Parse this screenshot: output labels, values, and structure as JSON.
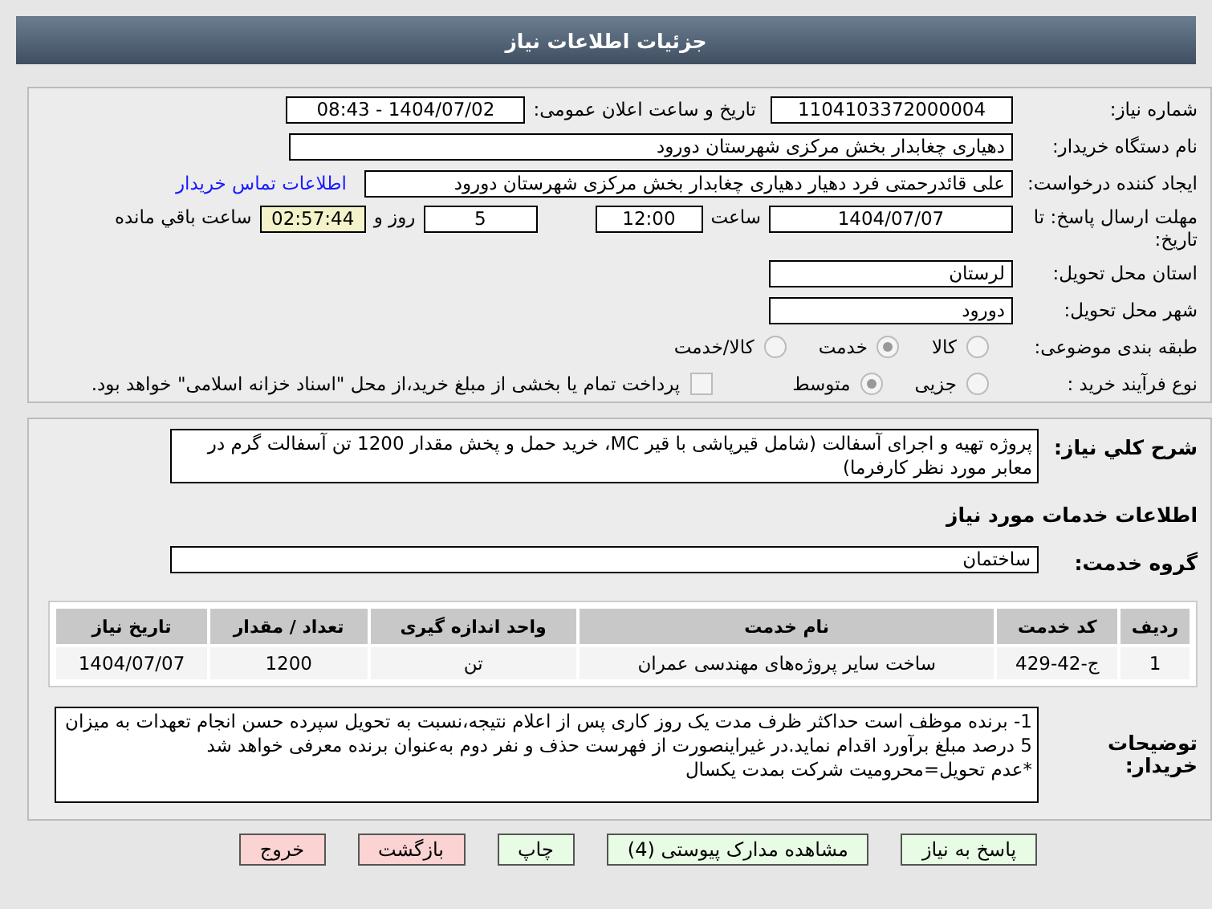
{
  "window": {
    "title": "جزئیات اطلاعات نیاز"
  },
  "form": {
    "need_number": {
      "label": "شماره نیاز:",
      "value": "1104103372000004"
    },
    "announce": {
      "label": "تاریخ و ساعت اعلان عمومی:",
      "value": "1404/07/02 - 08:43"
    },
    "buyer_org": {
      "label": "نام دستگاه خریدار:",
      "value": "دهیاری چغابدار بخش مرکزی شهرستان دورود"
    },
    "requester": {
      "label": "ایجاد کننده درخواست:",
      "value": "علی قائدرحمتی فرد دهیار دهیاری چغابدار بخش مرکزی شهرستان دورود",
      "link": "اطلاعات تماس خریدار"
    },
    "deadline": {
      "label": "مهلت ارسال پاسخ: تا تاریخ:",
      "date": "1404/07/07",
      "time_label": "ساعت",
      "time": "12:00",
      "days": "5",
      "days_label": "روز و",
      "remaining": "02:57:44",
      "remaining_label": "ساعت باقي مانده"
    },
    "province": {
      "label": "استان محل تحویل:",
      "value": "لرستان"
    },
    "city": {
      "label": "شهر محل تحویل:",
      "value": "دورود"
    },
    "category": {
      "label": "طبقه بندی موضوعی:",
      "options": [
        {
          "label": "کالا",
          "selected": false
        },
        {
          "label": "خدمت",
          "selected": true
        },
        {
          "label": "کالا/خدمت",
          "selected": false
        }
      ]
    },
    "process": {
      "label": "نوع فرآیند خرید :",
      "options": [
        {
          "label": "جزیی",
          "selected": false
        },
        {
          "label": "متوسط",
          "selected": true
        }
      ],
      "payment": {
        "label": "پرداخت تمام یا بخشی از مبلغ خرید،از محل \"اسناد خزانه اسلامی\" خواهد بود.",
        "checked": false
      }
    }
  },
  "details": {
    "description": {
      "label": "شرح کلي نياز:",
      "value": "پروژه تهیه و اجرای آسفالت (شامل قیرپاشی با قیر MC، خرید حمل و پخش مقدار 1200 تن آسفالت گرم در معابر مورد نظر کارفرما)"
    },
    "services_title": "اطلاعات خدمات مورد نیاز",
    "service_group": {
      "label": "گروه خدمت:",
      "value": "ساختمان"
    },
    "table": {
      "columns": [
        "ردیف",
        "کد خدمت",
        "نام خدمت",
        "واحد اندازه گیری",
        "تعداد / مقدار",
        "تاریخ نیاز"
      ],
      "rows": [
        [
          "1",
          "ج-42-429",
          "ساخت سایر پروژه‌های مهندسی عمران",
          "تن",
          "1200",
          "1404/07/07"
        ]
      ]
    },
    "notes": {
      "label": "توضیحات خریدار:",
      "value": "1- برنده موظف است حداکثر ظرف مدت یک روز کاری پس از اعلام نتیجه،نسبت به تحویل سپرده حسن انجام تعهدات به میزان 5 درصد مبلغ برآورد اقدام نماید.در غیراینصورت از فهرست حذف و نفر دوم به‌عنوان برنده معرفی خواهد شد\n*عدم تحویل=محرومیت شرکت بمدت یکسال"
    }
  },
  "buttons": [
    {
      "label": "پاسخ به نیاز",
      "kind": "action"
    },
    {
      "label": "مشاهده مدارک پیوستی (4)",
      "kind": "action"
    },
    {
      "label": "چاپ",
      "kind": "action"
    },
    {
      "label": "بازگشت",
      "kind": "exit"
    },
    {
      "label": "خروج",
      "kind": "exit"
    }
  ]
}
